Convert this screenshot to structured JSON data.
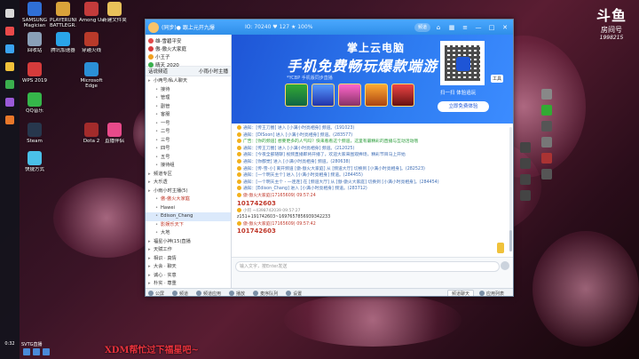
{
  "desktop_icons": [
    {
      "label": "SAMSUNG Magician",
      "color": "#2f6fd6"
    },
    {
      "label": "PLAYERUNKNOWN'S BATTLEGR...",
      "color": "#d9a23a"
    },
    {
      "label": "Among Us",
      "color": "#c43b3b"
    },
    {
      "label": "新建文件夹",
      "color": "#e8c15a"
    },
    {
      "label": "回收站",
      "color": "#8aa0b8"
    },
    {
      "label": "腾讯加速器",
      "color": "#2aa4e8"
    },
    {
      "label": "穿越火线",
      "color": "#b83a2a"
    },
    {
      "label": "WPS 2019",
      "color": "#d63b3b"
    },
    {
      "label": "Microsoft Edge",
      "color": "#2b8fd6"
    },
    {
      "label": "QQ音乐",
      "color": "#35b64a"
    },
    {
      "label": "Steam",
      "color": "#27374d"
    },
    {
      "label": "Dota 2",
      "color": "#a32b2b"
    },
    {
      "label": "直播伴侣",
      "color": "#e84a8a"
    },
    {
      "label": "快捷方式",
      "color": "#4ac0e8"
    }
  ],
  "window": {
    "title": "(同步)● 跟上元开九爆",
    "stats": "IO: 70240  ♥ 127  ★ 100%",
    "pill": "频道",
    "controls": {
      "min": "—",
      "max": "□",
      "close": "✕"
    }
  },
  "left_pane": {
    "top_rows": [
      {
        "text": "雄-雪碧平安",
        "color": "#e24a4a"
      },
      {
        "text": "傲-傲火大家庭",
        "color": "#d93b3b"
      },
      {
        "text": "小王子",
        "color": "#f0a020"
      },
      {
        "text": "晴天 2020",
        "color": "#3ab04e"
      }
    ],
    "header_label": "话说频道",
    "header_right": "小雨小时主播",
    "tree": [
      {
        "text": "小两号/私人聊天",
        "indent": 0,
        "style": ""
      },
      {
        "text": "接待",
        "indent": 1,
        "style": ""
      },
      {
        "text": "管理",
        "indent": 1,
        "style": ""
      },
      {
        "text": "副管",
        "indent": 1,
        "style": ""
      },
      {
        "text": "客服",
        "indent": 1,
        "style": ""
      },
      {
        "text": "一号",
        "indent": 1,
        "style": ""
      },
      {
        "text": "二号",
        "indent": 1,
        "style": ""
      },
      {
        "text": "三号",
        "indent": 1,
        "style": ""
      },
      {
        "text": "四号",
        "indent": 1,
        "style": ""
      },
      {
        "text": "五号",
        "indent": 1,
        "style": ""
      },
      {
        "text": "接待组",
        "indent": 1,
        "style": ""
      },
      {
        "text": "频道专区",
        "indent": 0,
        "style": ""
      },
      {
        "text": "大乐透",
        "indent": 0,
        "style": ""
      },
      {
        "text": "小雨小时主播(5)",
        "indent": 0,
        "style": ""
      },
      {
        "text": "傲-傲火大家庭",
        "indent": 1,
        "style": "user"
      },
      {
        "text": "Hawei",
        "indent": 1,
        "style": ""
      },
      {
        "text": "Edison_Chang",
        "indent": 1,
        "style": "hl"
      },
      {
        "text": "影娱乐天下",
        "indent": 1,
        "style": "user"
      },
      {
        "text": "大地",
        "indent": 1,
        "style": ""
      },
      {
        "text": "福星小神(15)直播",
        "indent": 0,
        "style": ""
      },
      {
        "text": "天赋工作",
        "indent": 0,
        "style": ""
      },
      {
        "text": "相识 · 真情",
        "indent": 0,
        "style": ""
      },
      {
        "text": "大会 · 聊天",
        "indent": 0,
        "style": ""
      },
      {
        "text": "诚心 · 实意",
        "indent": 0,
        "style": ""
      },
      {
        "text": "朴实 · 尊重",
        "indent": 0,
        "style": ""
      },
      {
        "text": "心灵 · 花园",
        "indent": 0,
        "style": ""
      },
      {
        "text": "词赏 · 山茶",
        "indent": 0,
        "style": ""
      }
    ]
  },
  "banner": {
    "line1": "掌上云电脑",
    "line2": "手机免费畅玩爆款端游",
    "line3": "*YCBP 手机版同步直播",
    "scan_text": "扫一扫 体验追玩",
    "button_label": "立即免费体验",
    "side_tool": "工具"
  },
  "chat": {
    "lines": [
      {
        "text": "通知：[传王刀圈] 进入 [小满小时亮相身] 频道。(191023)",
        "style": "blue"
      },
      {
        "text": "通知：[DISoon] 进入 [小满小时亮相身] 频道。(283577)",
        "style": "blue"
      },
      {
        "text": "广告：[你的频道] 想要更多的人气吗？快来看看这个频道，这里有最精彩的直播与互动活动哦",
        "style": "green"
      },
      {
        "text": "通知：[传王刀圈] 进入 [小满小时亮相身] 频道。(212025)",
        "style": "blue"
      },
      {
        "text": "通知：[今夜全部随聊] 视频直播即将开播了，欢迎大家来围观捧场，精彩节目马上开始",
        "style": "blue"
      },
      {
        "text": "通知：[你都觉] 进入 [小满小时亮相身] 频道。(280638)",
        "style": "blue"
      },
      {
        "text": "通知：[传-雪-小] 离开频道 [傲-傲火大家庭] 从 [频道大厅] 切换到 [小满小时亮相身]。(282523)",
        "style": "blue"
      },
      {
        "text": "通知：[一个明天主个] 进入 [小满小时亮相身] 频道。(284455)",
        "style": "blue"
      },
      {
        "text": "通知：[一个明天主个 - 一连连] 在 [频道大厅] 从 [傲-傲火大家庭] 切换到 [小满小时亮相身]。(284454)",
        "style": "blue"
      },
      {
        "text": "通知：[Edison_Chang] 进入 [小满小时亮相身] 频道。(283712)",
        "style": "blue"
      }
    ],
    "sender1": "傲-傲火大家庭(17165609) 09:57:24",
    "msg1": "101742603",
    "sender2": "小何 ~4398742039 09:57:27",
    "msg2": "z151+191742603~1697657856939342233",
    "sender3": "傲-傲火大家庭(17165609) 09:57:42",
    "msg3": "101742603"
  },
  "input": {
    "placeholder": "输入文字，按Enter发送"
  },
  "bottombar": {
    "items": [
      "公屏",
      "频道",
      "频道应用",
      "播放",
      "麦序队列",
      "设置"
    ],
    "right_select": "频道聊天",
    "right_btn": "应用列表"
  },
  "logo": {
    "line1": "斗鱼",
    "line2": "房间号",
    "line3": "1998215"
  },
  "caption": "XDM帮忙过下福星吧~",
  "bottom_label": "SVTG直播",
  "clock": "0:32"
}
